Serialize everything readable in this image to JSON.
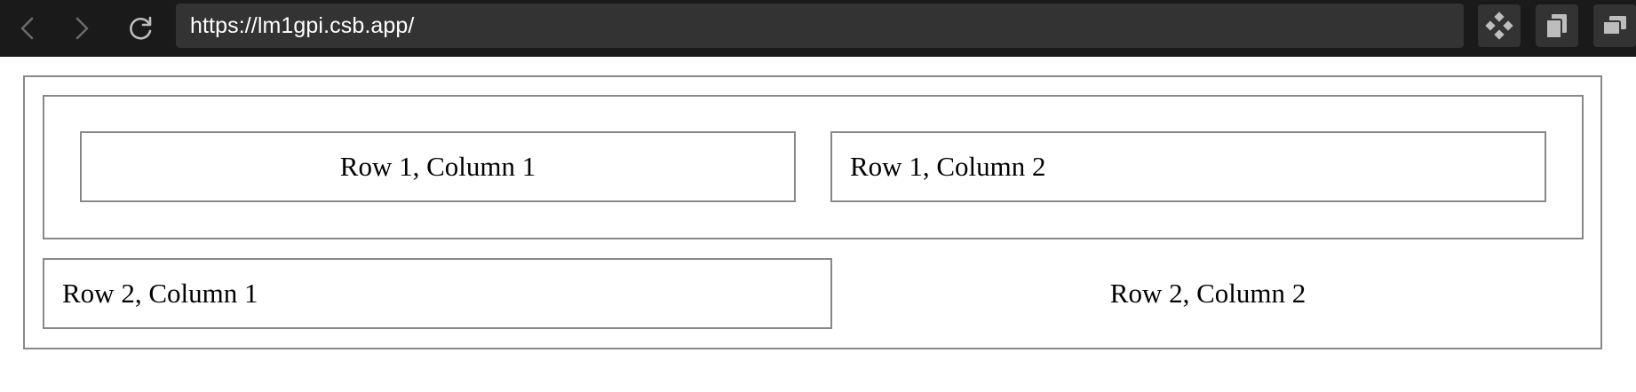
{
  "browser": {
    "url": "https://lm1gpi.csb.app/",
    "icons": {
      "back": "arrow-left-icon",
      "forward": "arrow-right-icon",
      "reload": "reload-icon",
      "tool_1": "diamond-grid-icon",
      "tool_2": "copy-icon",
      "tool_3": "windows-icon"
    },
    "colors": {
      "chrome_bg": "#1a1a1a",
      "address_bg": "#333333",
      "icon_dim": "#6b6b6b",
      "icon_active": "#bdbdbd"
    }
  },
  "page": {
    "border_color": "#888888",
    "rows": [
      {
        "cells": [
          {
            "label": "Row 1, Column 1"
          },
          {
            "label": "Row 1, Column 2"
          }
        ]
      },
      {
        "cells": [
          {
            "label": "Row 2, Column 1"
          },
          {
            "label": "Row 2, Column 2"
          }
        ]
      }
    ]
  }
}
